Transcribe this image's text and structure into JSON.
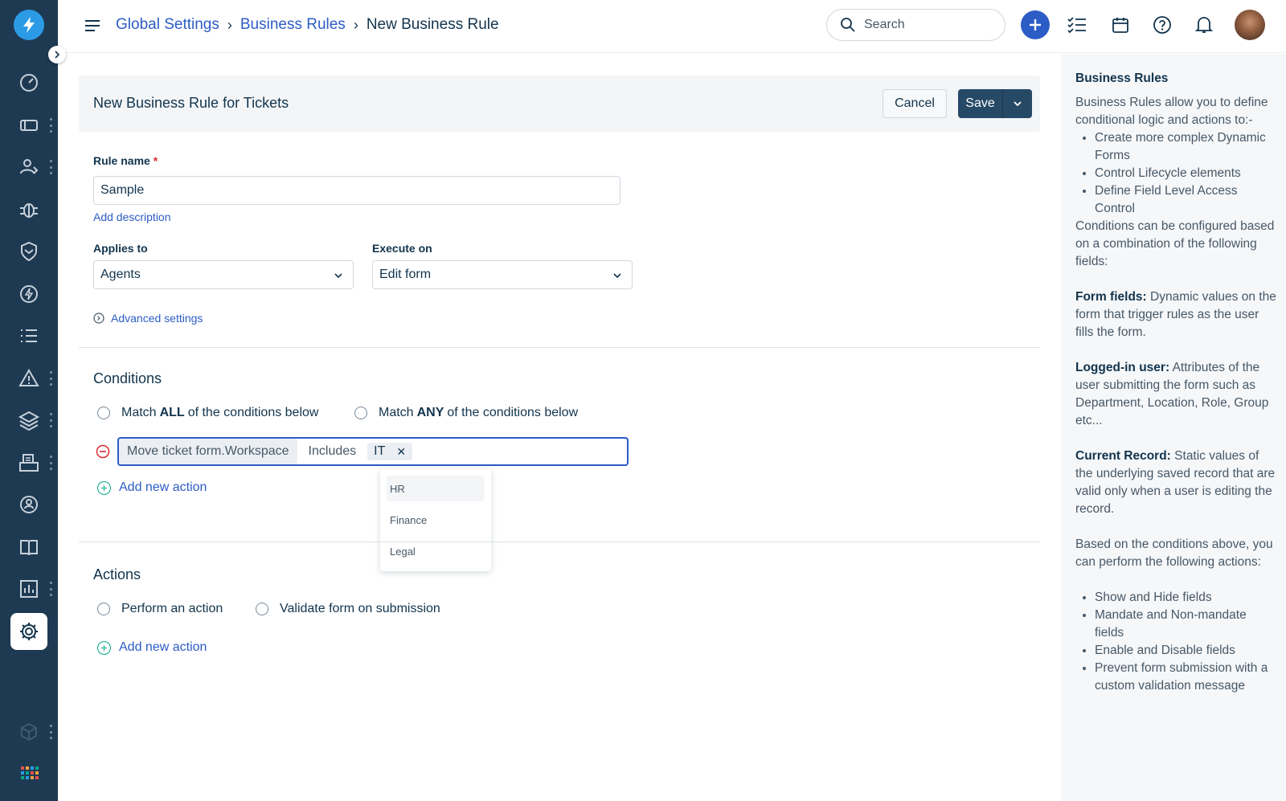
{
  "breadcrumb": {
    "item1": "Global Settings",
    "item2": "Business Rules",
    "current": "New Business Rule"
  },
  "search": {
    "placeholder": "Search"
  },
  "header": {
    "title": "New Business Rule for Tickets",
    "cancel_label": "Cancel",
    "save_label": "Save"
  },
  "form": {
    "rule_name_label": "Rule name",
    "required_mark": "*",
    "rule_name_value": "Sample",
    "add_description": "Add description",
    "applies_to_label": "Applies to",
    "applies_to_value": "Agents",
    "execute_on_label": "Execute on",
    "execute_on_value": "Edit form",
    "advanced_settings": "Advanced settings"
  },
  "conditions": {
    "title": "Conditions",
    "match_all_pre": "Match",
    "match_all_bold": "ALL",
    "match_all_post": "of the conditions below",
    "match_any_pre": "Match",
    "match_any_bold": "ANY",
    "match_any_post": "of the conditions below",
    "row": {
      "field": "Move ticket form.Workspace",
      "operator": "Includes",
      "value": "IT"
    },
    "add_new_action": "Add new action",
    "dropdown_options": [
      "HR",
      "Finance",
      "Legal"
    ]
  },
  "actions": {
    "title": "Actions",
    "option1": "Perform an action",
    "option2": "Validate form on submission",
    "add_new_action": "Add new action"
  },
  "help": {
    "title": "Business Rules",
    "intro": "Business Rules allow you to define conditional logic and actions to:-",
    "intro_list": [
      "Create more complex Dynamic Forms",
      "Control Lifecycle elements",
      "Define Field Level Access Control"
    ],
    "conditions_text": "Conditions can be configured based on a combination of the following fields:",
    "form_fields_label": "Form fields:",
    "form_fields_text": "Dynamic values on the form that trigger rules as the user fills the form.",
    "logged_in_label": "Logged-in user:",
    "logged_in_text": "Attributes of the user submitting the form such as Department, Location, Role, Group etc...",
    "current_record_label": "Current Record:",
    "current_record_text": "Static values of the underlying saved record that are valid only when a user is editing the record.",
    "actions_text": "Based on the conditions above, you can perform the following actions:",
    "actions_list": [
      "Show and Hide fields",
      "Mandate and Non-mandate fields",
      "Enable and Disable fields",
      "Prevent form submission with a custom validation message"
    ]
  },
  "colors": {
    "sidebar": "#1e3a52",
    "link": "#2c5cc5",
    "primary_button": "#264966",
    "add_icon": "#00a886"
  }
}
